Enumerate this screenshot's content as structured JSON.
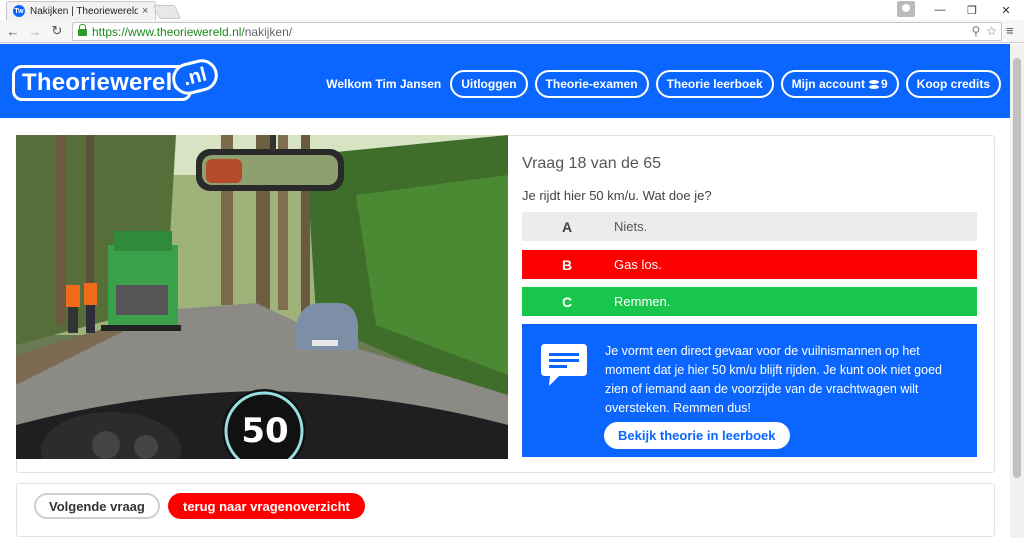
{
  "browser": {
    "tab_title": "Nakijken | Theoriewereld.n",
    "favicon_text": "Tw",
    "url_host": "https://www.theoriewereld.nl",
    "url_path": "/nakijken/"
  },
  "header": {
    "logo_text": "Theoriewereld",
    "logo_suffix": ".nl",
    "welcome": "Welkom Tim Jansen",
    "nav": {
      "logout": "Uitloggen",
      "exam": "Theorie-examen",
      "book": "Theorie leerboek",
      "account": "Mijn account",
      "credits_count": "9",
      "buy_credits": "Koop credits"
    }
  },
  "question": {
    "title": "Vraag 18 van de 65",
    "text": "Je rijdt hier 50 km/u. Wat doe je?",
    "speed_display": "50",
    "answers": [
      {
        "letter": "A",
        "text": "Niets.",
        "state": "neutral"
      },
      {
        "letter": "B",
        "text": "Gas los.",
        "state": "wrong"
      },
      {
        "letter": "C",
        "text": "Remmen.",
        "state": "correct"
      }
    ],
    "explanation": "Je vormt een direct gevaar voor de vuilnismannen op het moment dat je hier 50 km/u blijft rijden. Je kunt ook niet goed zien of iemand aan de voorzijde van de vrachtwagen wilt oversteken. Remmen dus!",
    "theory_button": "Bekijk theorie in leerboek"
  },
  "footer": {
    "next": "Volgende vraag",
    "back": "terug naar vragenoverzicht"
  },
  "colors": {
    "brand": "#0a66ff",
    "wrong": "#ff0000",
    "correct": "#17c64a"
  }
}
